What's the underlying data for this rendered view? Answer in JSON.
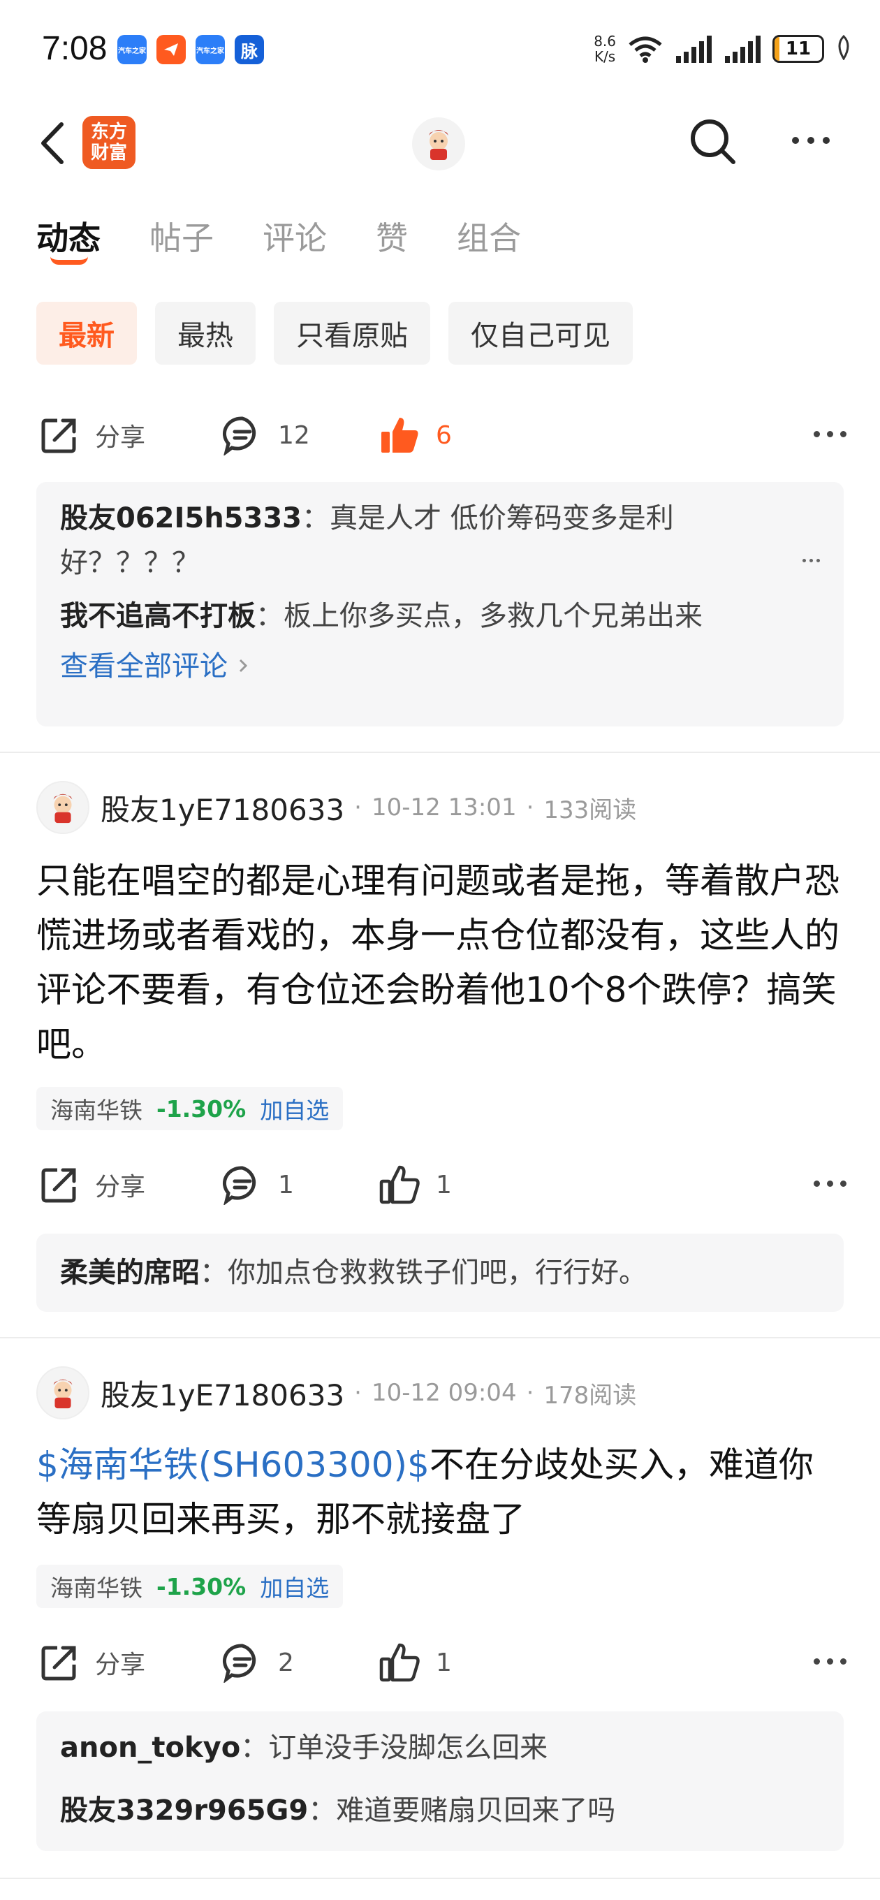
{
  "status_bar": {
    "time": "7:08",
    "notifications": [
      "汽车之家",
      "",
      "汽车之家",
      "脉"
    ],
    "net_speed_value": "8.6",
    "net_speed_unit": "K/s",
    "battery": "11",
    "battery_level": 0.11
  },
  "header": {
    "brand_line1": "东方",
    "brand_line2": "财富"
  },
  "tabs": [
    {
      "label": "动态"
    },
    {
      "label": "帖子"
    },
    {
      "label": "评论"
    },
    {
      "label": "赞"
    },
    {
      "label": "组合"
    }
  ],
  "filters": [
    {
      "label": "最新"
    },
    {
      "label": "最热"
    },
    {
      "label": "只看原贴"
    },
    {
      "label": "仅自己可见"
    }
  ],
  "top_card": {
    "share_label": "分享",
    "comment_count": "12",
    "like_count": "6",
    "comments": [
      {
        "name": "股友062I5h5333",
        "text": "真是人才 低价筹码变多是利好？？？？"
      },
      {
        "name": "我不追高不打板",
        "text": "板上你多买点，多救几个兄弟出来"
      }
    ],
    "view_all": "查看全部评论"
  },
  "posts": [
    {
      "author": "股友1yE7180633",
      "date": "10-12 13:01",
      "reads": "133阅读",
      "link": "",
      "body": "只能在唱空的都是心理有问题或者是拖，等着散户恐慌进场或者看戏的，本身一点仓位都没有，这些人的评论不要看，有仓位还会盼着他10个8个跌停？搞笑吧。",
      "stock_name": "海南华铁",
      "stock_change": "-1.30%",
      "add_watch": "加自选",
      "share_label": "分享",
      "comment_count": "1",
      "like_count": "1",
      "comments": [
        {
          "name": "柔美的席昭",
          "text": "你加点仓救救铁子们吧，行行好。"
        }
      ]
    },
    {
      "author": "股友1yE7180633",
      "date": "10-12 09:04",
      "reads": "178阅读",
      "link": "$海南华铁(SH603300)$",
      "body": "不在分歧处买入，难道你等扇贝回来再买，那不就接盘了",
      "stock_name": "海南华铁",
      "stock_change": "-1.30%",
      "add_watch": "加自选",
      "share_label": "分享",
      "comment_count": "2",
      "like_count": "1",
      "comments": [
        {
          "name": "anon_tokyo",
          "text": "订单没手没脚怎么回来"
        },
        {
          "name": "股友3329r965G9",
          "text": "难道要赌扇贝回来了吗"
        }
      ]
    }
  ]
}
